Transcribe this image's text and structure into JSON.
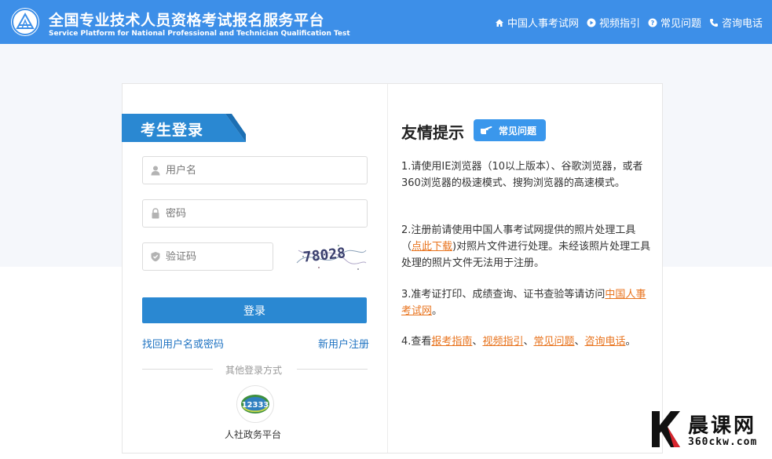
{
  "header": {
    "title_cn": "全国专业技术人员资格考试报名服务平台",
    "title_en": "Service Platform for National Professional and Technician Qualification Test",
    "nav": [
      {
        "label": "中国人事考试网",
        "icon": "home-icon"
      },
      {
        "label": "视频指引",
        "icon": "play-icon"
      },
      {
        "label": "常见问题",
        "icon": "question-icon"
      },
      {
        "label": "咨询电话",
        "icon": "phone-icon"
      }
    ]
  },
  "login": {
    "title": "考生登录",
    "username_placeholder": "用户名",
    "password_placeholder": "密码",
    "captcha_placeholder": "验证码",
    "captcha_text": "78028",
    "login_button": "登录",
    "forgot_link": "找回用户名或密码",
    "register_link": "新用户注册",
    "other_login_label": "其他登录方式",
    "gov_platform_label": "人社政务平台",
    "gov_logo_text": "12333"
  },
  "tips": {
    "title": "友情提示",
    "faq_button": "常见问题",
    "tip1": "1.请使用IE浏览器（10以上版本）、谷歌浏览器，或者360浏览器的极速模式、搜狗浏览器的高速模式。",
    "tip2_before": "2.注册前请使用中国人事考试网提供的照片处理工具（",
    "tip2_link": "点此下载",
    "tip2_after": ")对照片文件进行处理。未经该照片处理工具处理的照片文件无法用于注册。",
    "tip3_before": "3.准考证打印、成绩查询、证书查验等请访问",
    "tip3_link": "中国人事考试网",
    "tip3_after": "。",
    "tip4_before": "4.查看",
    "tip4_link1": "报考指南",
    "tip4_sep1": "、",
    "tip4_link2": "视频指引",
    "tip4_sep2": "、",
    "tip4_link3": "常见问题",
    "tip4_sep3": "、",
    "tip4_link4": "咨询电话",
    "tip4_after": "。"
  },
  "watermark": {
    "name": "晨课网",
    "url": "360ckw.com"
  },
  "colors": {
    "header_blue": "#3d8fe8",
    "button_blue": "#2a88d2",
    "link_orange": "#e8731d",
    "link_blue": "#1f73c2"
  }
}
